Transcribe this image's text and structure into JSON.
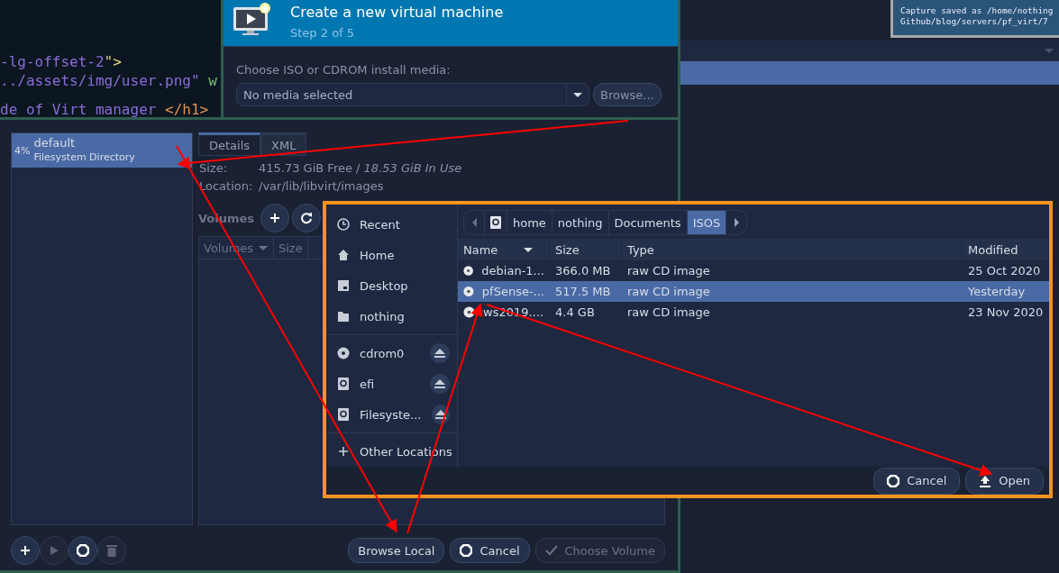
{
  "code_editor": {
    "lines": [
      [
        {
          "text": "-lg-offset-2",
          "kind": "string"
        },
        {
          "text": "\">",
          "kind": "punct"
        }
      ],
      [
        {
          "text": "../assets/img/user.png\" ",
          "kind": "string"
        },
        {
          "text": "w",
          "kind": "attr"
        }
      ],
      [
        {
          "text": "de of Virt manager ",
          "kind": "string"
        },
        {
          "text": "</h1>",
          "kind": "tag"
        }
      ]
    ]
  },
  "background_window": {
    "rows": [
      {
        "selected": true
      }
    ]
  },
  "notification": {
    "lines": [
      "Capture saved as /home/nothing",
      "Github/blog/servers/pf_virt/7"
    ]
  },
  "new_vm_window": {
    "title": "Create a new virtual machine",
    "subtitle": "Step 2 of 5",
    "media_label": "Choose ISO or CDROM install media:",
    "media_value": "No media selected",
    "browse_button": "Browse..."
  },
  "storage_window": {
    "pools": [
      {
        "usage": "4%",
        "name": "default",
        "type": "Filesystem Directory",
        "selected": true
      }
    ],
    "tabs": [
      {
        "label": "Details",
        "selected": true
      },
      {
        "label": "XML",
        "selected": false
      }
    ],
    "details": [
      {
        "label": "Size:",
        "value": "415.73 GiB Free / *18.53 GiB In Use*"
      },
      {
        "label": "Location:",
        "value": "/var/lib/libvirt/images"
      }
    ],
    "volumes_label": "Volumes",
    "volume_columns": [
      "Volumes",
      "Size"
    ],
    "tool_buttons": [
      {
        "kind": "add",
        "disabled": false
      },
      {
        "kind": "start",
        "disabled": true
      },
      {
        "kind": "stop",
        "disabled": false
      },
      {
        "kind": "delete",
        "disabled": true
      }
    ],
    "buttons": [
      {
        "kind": "plain",
        "label": "Browse Local",
        "disabled": false
      },
      {
        "kind": "cancel",
        "label": "Cancel",
        "disabled": false
      },
      {
        "kind": "choose",
        "label": "Choose Volume",
        "disabled": true
      }
    ]
  },
  "file_dialog": {
    "places": [
      {
        "label": "Recent",
        "kind": "place"
      },
      {
        "label": "Home",
        "kind": "place"
      },
      {
        "label": "Desktop",
        "kind": "place"
      },
      {
        "label": "nothing",
        "kind": "place"
      },
      {
        "label": "cdrom0",
        "kind": "device"
      },
      {
        "label": "efi",
        "kind": "device"
      },
      {
        "label": "Filesyste...",
        "kind": "device"
      },
      {
        "label": "Other Locations",
        "kind": "other"
      }
    ],
    "path": [
      {
        "label": "home",
        "selected": false
      },
      {
        "label": "nothing",
        "selected": false
      },
      {
        "label": "Documents",
        "selected": false
      },
      {
        "label": "ISOS",
        "selected": true
      }
    ],
    "columns": [
      "Name",
      "Size",
      "Type",
      "Modified"
    ],
    "rows": [
      {
        "name": "debian-1...",
        "size": "366.0  MB",
        "type": "raw CD image",
        "modified": "25 Oct 2020",
        "selected": false
      },
      {
        "name": "pfSense-...",
        "size": "517.5  MB",
        "type": "raw CD image",
        "modified": "Yesterday",
        "selected": true
      },
      {
        "name": "ws2019....",
        "size": "4.4  GB",
        "type": "raw CD image",
        "modified": "23 Nov 2020",
        "selected": false
      }
    ],
    "cancel_button": "Cancel",
    "open_button": "Open"
  }
}
